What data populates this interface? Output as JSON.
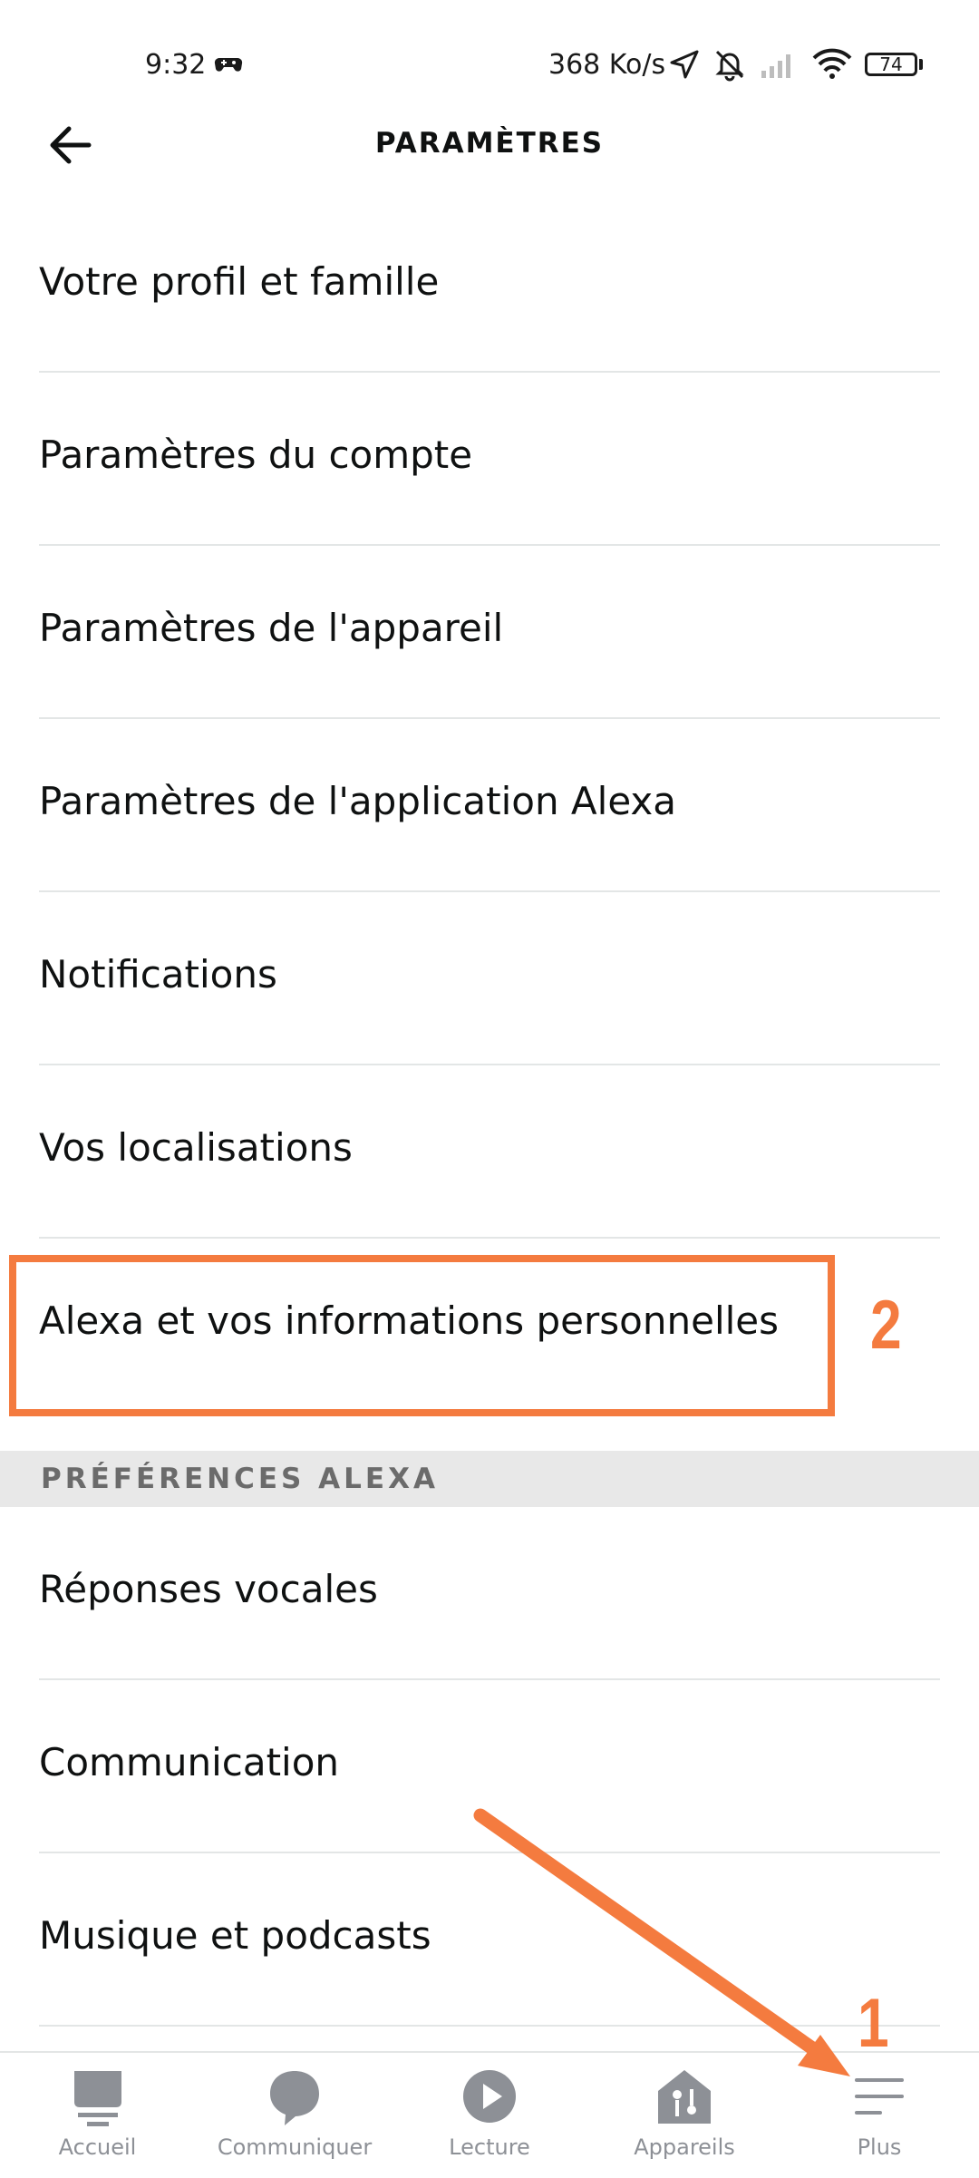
{
  "status_bar": {
    "time": "9:32",
    "speed": "368 Ko/s",
    "battery": "74",
    "icons": [
      "game-controller-icon",
      "location-arrow-icon",
      "bell-muted-icon",
      "signal-icon",
      "wifi-icon",
      "battery-icon"
    ]
  },
  "header": {
    "title": "PARAMÈTRES",
    "back_icon": "arrow-left-icon"
  },
  "settings": {
    "items": [
      {
        "label": "Votre profil et famille"
      },
      {
        "label": "Paramètres du compte"
      },
      {
        "label": "Paramètres de l'appareil"
      },
      {
        "label": "Paramètres de l'application Alexa"
      },
      {
        "label": "Notifications"
      },
      {
        "label": "Vos localisations"
      },
      {
        "label": "Alexa et vos informations personnelles"
      }
    ]
  },
  "section": {
    "title": "PRÉFÉRENCES ALEXA"
  },
  "preferences": {
    "items": [
      {
        "label": "Réponses vocales"
      },
      {
        "label": "Communication"
      },
      {
        "label": "Musique et podcasts"
      }
    ]
  },
  "annotations": {
    "step1": "1",
    "step2": "2",
    "color": "#f47b3f"
  },
  "bottom_nav": {
    "items": [
      {
        "label": "Accueil",
        "icon": "home-icon"
      },
      {
        "label": "Communiquer",
        "icon": "chat-bubble-icon"
      },
      {
        "label": "Lecture",
        "icon": "play-icon"
      },
      {
        "label": "Appareils",
        "icon": "devices-icon"
      },
      {
        "label": "Plus",
        "icon": "menu-icon"
      }
    ]
  },
  "colors": {
    "accent": "#f47b3f",
    "text": "#0f1111",
    "nav_inactive": "#8d9096",
    "divider": "#e3e6e6",
    "section_bg": "#e8e8e8"
  }
}
